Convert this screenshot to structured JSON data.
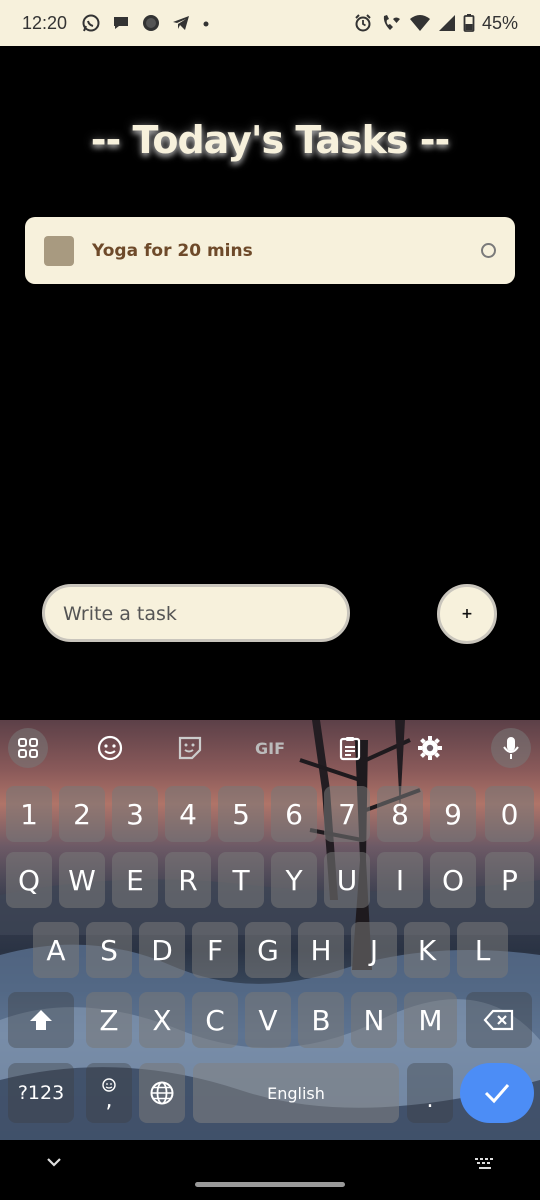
{
  "status_bar": {
    "time": "12:20",
    "battery": "45%",
    "notif_icons": [
      "whatsapp-icon",
      "chat-bubble-icon",
      "signal-app-icon",
      "telegram-icon",
      "more-dot-icon"
    ],
    "system_icons": [
      "alarm-icon",
      "wifi-calling-icon",
      "wifi-icon",
      "cell-signal-icon",
      "battery-icon"
    ]
  },
  "header": {
    "title": "-- Today's Tasks --"
  },
  "tasks": [
    {
      "label": "Yoga for 20 mins"
    }
  ],
  "composer": {
    "placeholder": "Write a task",
    "add_label": "+"
  },
  "keyboard": {
    "toolbar": [
      "apps-grid-icon",
      "emoji-icon",
      "sticker-icon",
      "GIF",
      "clipboard-icon",
      "settings-icon",
      "mic-icon"
    ],
    "gif_label": "GIF",
    "row_numbers": [
      "1",
      "2",
      "3",
      "4",
      "5",
      "6",
      "7",
      "8",
      "9",
      "0"
    ],
    "row1": [
      "Q",
      "W",
      "E",
      "R",
      "T",
      "Y",
      "U",
      "I",
      "O",
      "P"
    ],
    "row2": [
      "A",
      "S",
      "D",
      "F",
      "G",
      "H",
      "J",
      "K",
      "L"
    ],
    "row3": [
      "Z",
      "X",
      "C",
      "V",
      "B",
      "N",
      "M"
    ],
    "symbols_label": "?123",
    "comma_label": ",",
    "space_label": "English",
    "period_label": ".",
    "accent_color": "#4c8df6"
  },
  "colors": {
    "cream": "#f7f1dc",
    "task_text": "#6e4a2a",
    "task_square": "#a89a80"
  }
}
